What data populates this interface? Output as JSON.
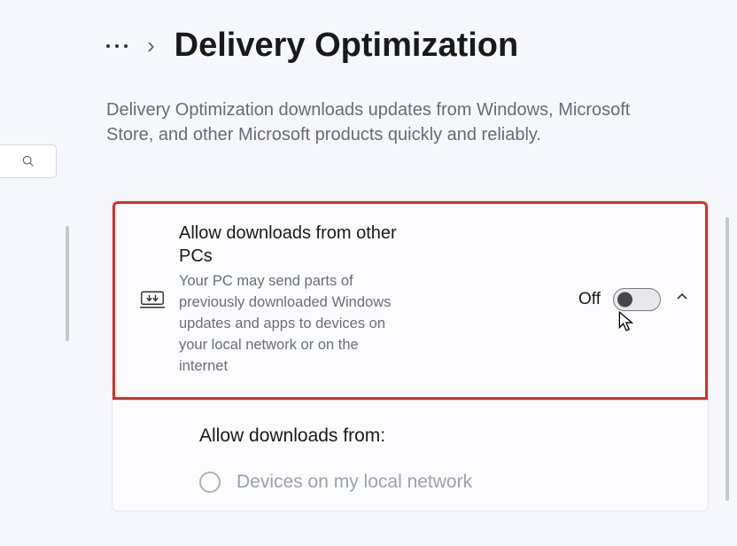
{
  "header": {
    "title": "Delivery Optimization",
    "description": "Delivery Optimization downloads updates from Windows, Microsoft Store, and other Microsoft products quickly and reliably."
  },
  "card": {
    "allow_downloads": {
      "title": "Allow downloads from other PCs",
      "subtitle": "Your PC may send parts of previously downloaded Windows updates and apps to devices on your local network or on the internet",
      "toggle_state": "Off"
    },
    "options": {
      "label": "Allow downloads from:",
      "radio1": "Devices on my local network"
    }
  }
}
